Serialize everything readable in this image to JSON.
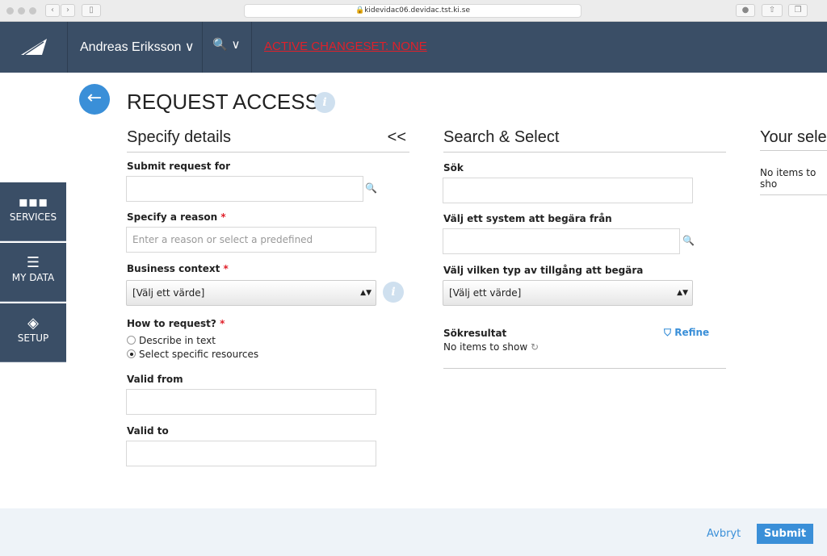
{
  "browser": {
    "url": "kidevidac06.devidac.tst.ki.se"
  },
  "topbar": {
    "user": "Andreas Eriksson",
    "changeset": "ACTIVE CHANGESET: NONE"
  },
  "sidebar": {
    "items": [
      {
        "label": "SERVICES",
        "icon": "grid-icon"
      },
      {
        "label": "MY DATA",
        "icon": "menu-icon"
      },
      {
        "label": "SETUP",
        "icon": "layers-icon"
      }
    ]
  },
  "page": {
    "title": "REQUEST ACCESS"
  },
  "details": {
    "heading": "Specify details",
    "collapse": "<<",
    "submit_for": "Submit request for",
    "reason_label": "Specify a reason",
    "reason_placeholder": "Enter a reason or select a predefined",
    "context_label": "Business context",
    "context_value": "[Välj] ett värde]",
    "how_label": "How to request?",
    "options": [
      "Describe in text",
      "Select specific resources"
    ],
    "selected_option": 1,
    "valid_from": "Valid from",
    "valid_to": "Valid to"
  },
  "search": {
    "heading": "Search & Select",
    "sok": "Sök",
    "system_label": "Välj ett system att begära från",
    "type_label": "Välj vilken typ av tillgång att begära",
    "type_value": "[Välj ett värde]",
    "results_label": "Sökresultat",
    "refine": "Refine",
    "empty": "No items to show"
  },
  "selection": {
    "heading": "Your sele",
    "empty": "No items to sho"
  },
  "footer": {
    "cancel": "Avbryt",
    "submit": "Submit"
  }
}
